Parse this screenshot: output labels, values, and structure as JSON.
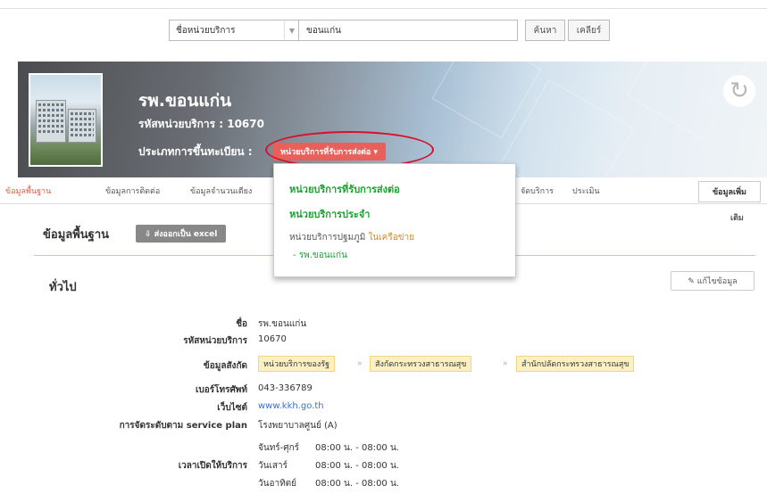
{
  "search": {
    "field": "ชื่อหน่วยบริการ",
    "query": "ขอนแก่น",
    "search_btn": "ค้นหา",
    "clear_btn": "เคลียร์"
  },
  "header": {
    "name": "รพ.ขอนแก่น",
    "code_line": "รหัสหน่วยบริการ : 10670",
    "reg_label": "ประเภทการขึ้นทะเบียน :",
    "reg_value": "หน่วยบริการที่รับการส่งต่อ ▾"
  },
  "dropdown": {
    "items": [
      "หน่วยบริการที่รับการส่งต่อ",
      "หน่วยบริการประจำ"
    ],
    "primary": "หน่วยบริการปฐมภูมิ",
    "network": "ในเครือข่าย",
    "sub": "- รพ.ขอนแก่น"
  },
  "tabs": [
    "ข้อมูลพื้นฐาน",
    "ข้อมูลการติดต่อ",
    "ข้อมูลจำนวนเตียง",
    "จัดบริการ",
    "ประเมิน"
  ],
  "more_tab": "ข้อมูลเพิ่ม",
  "more_tab_wrap": "เติม",
  "section": {
    "title": "ข้อมูลพื้นฐาน",
    "export": "⇩ ส่งออกเป็น excel",
    "general": "ทั่วไป",
    "edit": "✎ แก้ไขข้อมูล"
  },
  "info": {
    "name_label": "ชื่อ",
    "name": "รพ.ขอนแก่น",
    "code_label": "รหัสหน่วยบริการ",
    "code": "10670",
    "aff_label": "ข้อมูลสังกัด",
    "affiliation": [
      "หน่วยบริการของรัฐ",
      "สังกัดกระทรวงสาธารณสุข",
      "สำนักปลัดกระทรวงสาธารณสุข"
    ],
    "phone_label": "เบอร์โทรศัพท์",
    "phone": "043-336789",
    "web_label": "เว็บไซต์",
    "web": "www.kkh.go.th",
    "plan_label": "การจัดระดับตาม service plan",
    "plan": "โรงพยาบาลศูนย์ (A)",
    "hours_label": "เวลาเปิดให้บริการ",
    "hours": [
      {
        "day": "จันทร์-ศุกร์",
        "time": "08:00 น. - 08:00 น."
      },
      {
        "day": "วันเสาร์",
        "time": "08:00 น. - 08:00 น."
      },
      {
        "day": "วันอาทิตย์",
        "time": "08:00 น. - 08:00 น."
      }
    ]
  }
}
